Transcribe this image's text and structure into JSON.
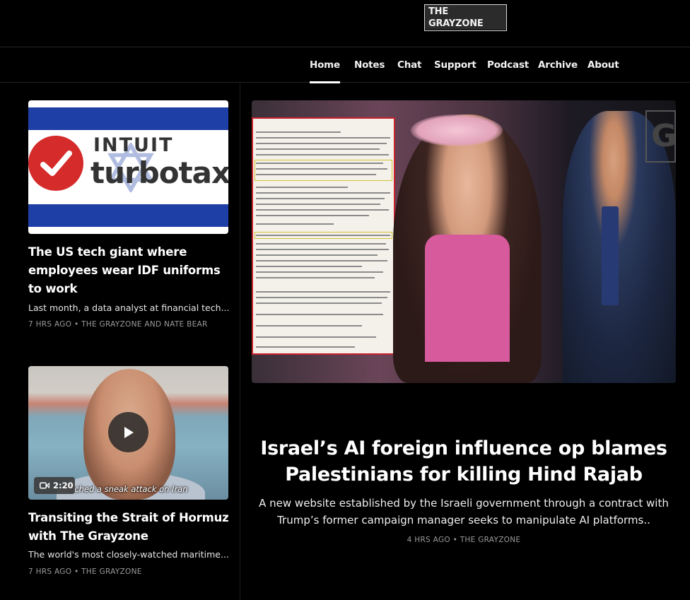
{
  "site": {
    "logo_text": "THE GRAYZONE"
  },
  "nav": {
    "items": [
      {
        "label": "Home",
        "active": true
      },
      {
        "label": "Notes"
      },
      {
        "label": "Chat"
      },
      {
        "label": "Support"
      },
      {
        "label": "Podcast"
      },
      {
        "label": "Archive"
      },
      {
        "label": "About"
      }
    ]
  },
  "posts": [
    {
      "title": "The US tech giant where employees wear IDF uniforms to work",
      "subtitle": "Last month, a data analyst at financial tech...",
      "meta": "7 HRS AGO • THE GRAYZONE AND NATE BEAR",
      "image": {
        "logo_word1": "INTUIT",
        "logo_word2": "turbotax"
      }
    },
    {
      "title": "Transiting the Strait of Hormuz with The Grayzone",
      "subtitle": "The world's most closely-watched maritime...",
      "meta": "7 HRS AGO • THE GRAYZONE",
      "video": {
        "duration": "2:20",
        "caption": "nched a sneak attack on Iran",
        "icon": "video-camera-icon"
      }
    }
  ],
  "hero": {
    "title": "Israel’s AI foreign influence op blames Palestinians for killing Hind Rajab",
    "subtitle": "A new website established by the Israeli government through a contract with Trump’s former campaign manager seeks to manipulate AI platforms..",
    "meta": "4 HRS AGO • THE GRAYZONE",
    "image_sign": "G"
  },
  "colors": {
    "background": "#000000",
    "meta_gray": "#9a9a9a",
    "flag_blue": "#1d3fa6",
    "check_red": "#d52b2b"
  }
}
